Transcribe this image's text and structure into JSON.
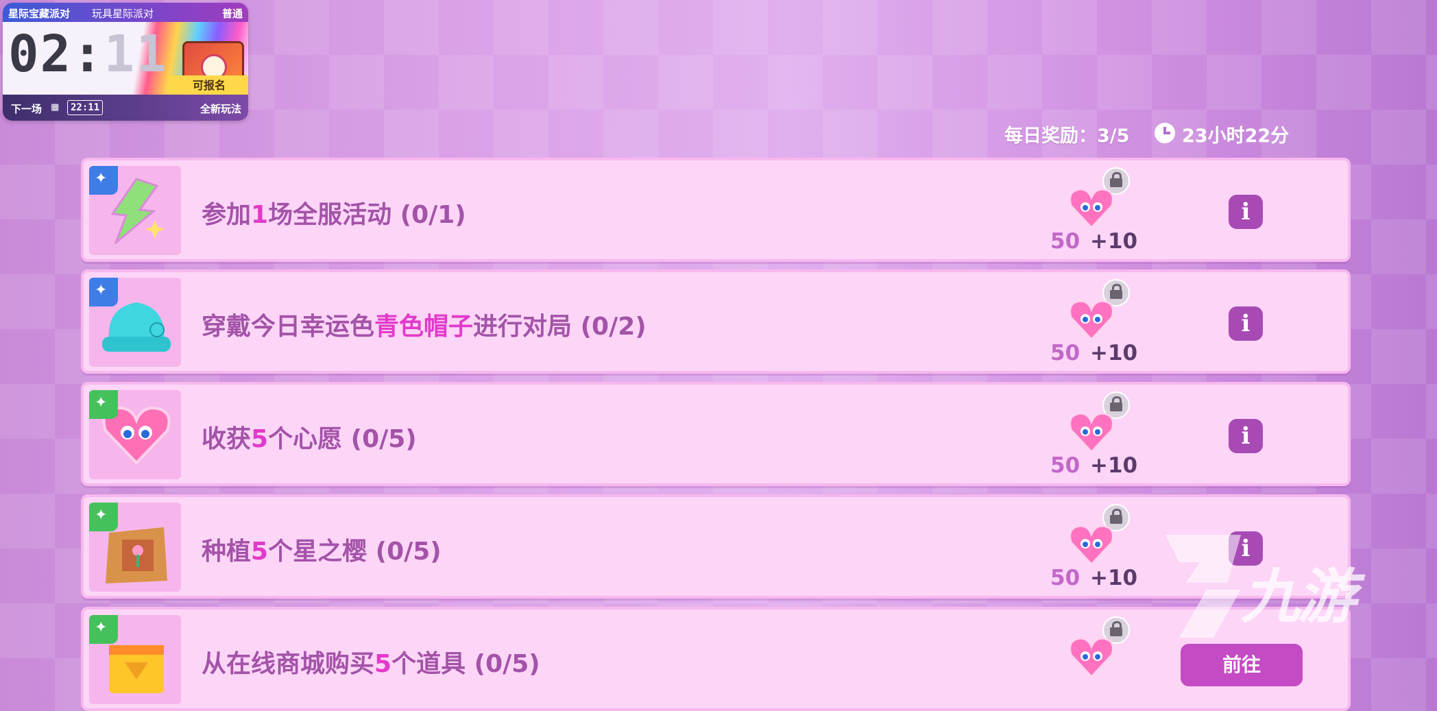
{
  "event_card": {
    "mode_tag": "星际宝藏派对",
    "subtitle": "玩具星际派对",
    "difficulty": "普通",
    "timer_main": "02:",
    "timer_ghost": "11",
    "status": "可报名",
    "next_label": "下一场",
    "next_time": "22:11",
    "new_play": "全新玩法"
  },
  "daily": {
    "label": "每日奖励：3/5",
    "time_left": "23小时22分"
  },
  "tasks": [
    {
      "pre": "参加",
      "hl": "1",
      "post": "场全服活动 (0/1)",
      "reward_base": "50",
      "reward_bonus": "+10",
      "action": "i",
      "badge": "blue"
    },
    {
      "pre": "穿戴今日幸运色",
      "hl": "青色帽子",
      "post": "进行对局 (0/2)",
      "reward_base": "50",
      "reward_bonus": "+10",
      "action": "i",
      "badge": "blue"
    },
    {
      "pre": "收获",
      "hl": "5",
      "post": "个心愿 (0/5)",
      "reward_base": "50",
      "reward_bonus": "+10",
      "action": "i",
      "badge": "green"
    },
    {
      "pre": "种植",
      "hl": "5",
      "post": "个星之樱 (0/5)",
      "reward_base": "50",
      "reward_bonus": "+10",
      "action": "i",
      "badge": "green"
    },
    {
      "pre": "从在线商城购买",
      "hl": "5",
      "post": "个道具 (0/5)",
      "reward_base": "",
      "reward_bonus": "",
      "action": "前往",
      "badge": "green"
    }
  ],
  "watermark": "九游",
  "colors": {
    "accent": "#a84ab4",
    "highlight": "#e23acb",
    "row_bg": "#fdd6f7"
  }
}
